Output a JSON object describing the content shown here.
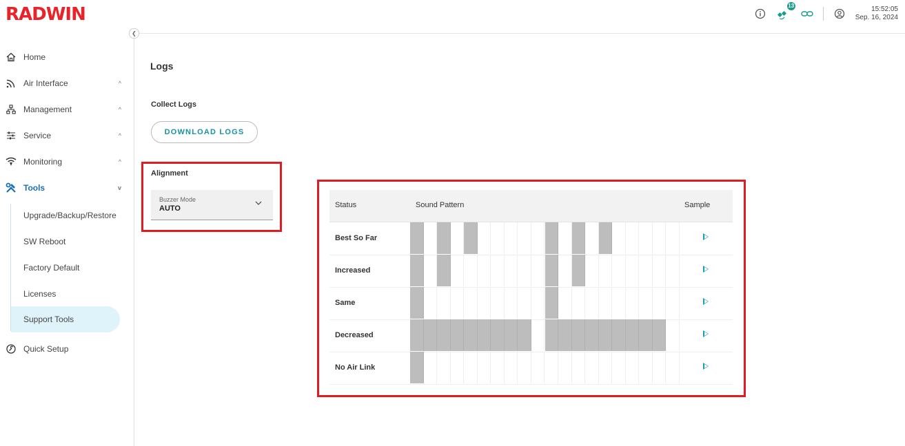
{
  "header": {
    "logo": "RADWIN",
    "satellite_badge": "13",
    "time": "15:52:05",
    "date": "Sep. 16, 2024",
    "icons": [
      "info-icon",
      "satellite-icon",
      "link-icon",
      "user-icon"
    ]
  },
  "sidebar": {
    "items": [
      {
        "label": "Home",
        "icon": "home-icon"
      },
      {
        "label": "Air Interface",
        "icon": "wifi-icon",
        "chevron": "^"
      },
      {
        "label": "Management",
        "icon": "network-icon",
        "chevron": "^"
      },
      {
        "label": "Service",
        "icon": "sliders-icon",
        "chevron": "^"
      },
      {
        "label": "Monitoring",
        "icon": "signal-icon",
        "chevron": "^"
      },
      {
        "label": "Tools",
        "icon": "tools-icon",
        "chevron": "v"
      }
    ],
    "tools_sub": [
      {
        "label": "Upgrade/Backup/Restore"
      },
      {
        "label": "SW Reboot"
      },
      {
        "label": "Factory Default"
      },
      {
        "label": "Licenses"
      },
      {
        "label": "Support Tools"
      }
    ],
    "quick_setup": "Quick Setup"
  },
  "main": {
    "title": "Logs",
    "collect_label": "Collect Logs",
    "download_button": "DOWNLOAD LOGS",
    "alignment_label": "Alignment",
    "buzzer": {
      "label": "Buzzer Mode",
      "value": "AUTO"
    },
    "table": {
      "headers": {
        "status": "Status",
        "pattern": "Sound Pattern",
        "sample": "Sample"
      },
      "rows": [
        {
          "status": "Best So Far",
          "pattern": [
            1,
            0,
            1,
            0,
            1,
            0,
            0,
            0,
            0,
            0,
            1,
            0,
            1,
            0,
            1,
            0,
            0,
            0,
            0,
            0
          ]
        },
        {
          "status": "Increased",
          "pattern": [
            1,
            0,
            1,
            0,
            0,
            0,
            0,
            0,
            0,
            0,
            1,
            0,
            1,
            0,
            0,
            0,
            0,
            0,
            0,
            0
          ]
        },
        {
          "status": "Same",
          "pattern": [
            1,
            0,
            0,
            0,
            0,
            0,
            0,
            0,
            0,
            0,
            1,
            0,
            0,
            0,
            0,
            0,
            0,
            0,
            0,
            0
          ]
        },
        {
          "status": "Decreased",
          "pattern": [
            1,
            1,
            1,
            1,
            1,
            1,
            1,
            1,
            1,
            0,
            1,
            1,
            1,
            1,
            1,
            1,
            1,
            1,
            1,
            0
          ]
        },
        {
          "status": "No Air Link",
          "pattern": [
            1,
            0,
            0,
            0,
            0,
            0,
            0,
            0,
            0,
            0,
            0,
            0,
            0,
            0,
            0,
            0,
            0,
            0,
            0,
            0
          ]
        }
      ]
    }
  },
  "colors": {
    "accent": "#1a9db5",
    "brand": "#e8232a",
    "highlight": "#e01b22",
    "active_bg": "#dff3fb"
  }
}
